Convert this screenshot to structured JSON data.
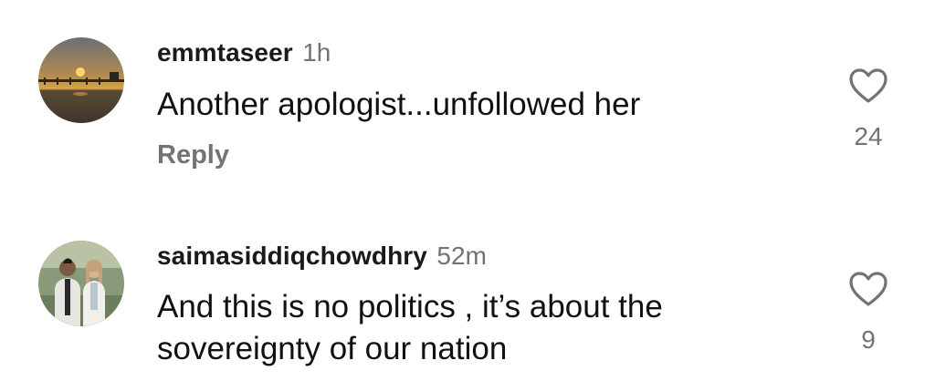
{
  "comments": [
    {
      "username": "emmtaseer",
      "time": "1h",
      "text": "Another apologist...unfollowed her",
      "reply_label": "Reply",
      "likes": "24",
      "avatar_icon": "sunset-pier-photo"
    },
    {
      "username": "saimasiddiqchowdhry",
      "time": "52m",
      "text": "And this is no politics , it’s about the sovereignty of our nation",
      "likes": "9",
      "avatar_icon": "couple-photo"
    }
  ],
  "colors": {
    "text": "#111111",
    "secondary": "#737373",
    "background": "#ffffff"
  }
}
